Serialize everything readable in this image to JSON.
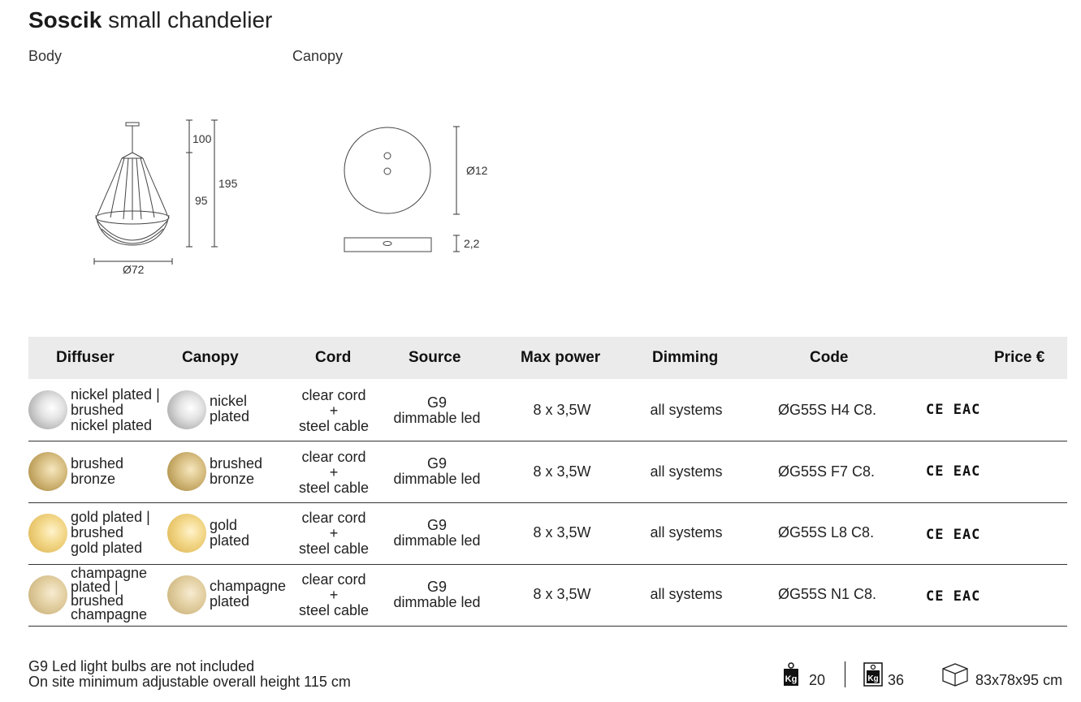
{
  "header": {
    "title_bold": "Soscik",
    "title_rest": "small chandelier",
    "body_label": "Body",
    "canopy_label": "Canopy"
  },
  "drawing": {
    "body_dims": {
      "top": "100",
      "lower": "95",
      "total": "195",
      "diameter": "Ø72"
    },
    "canopy_dims": {
      "diameter": "Ø12",
      "height": "2,2"
    }
  },
  "table": {
    "headers": [
      "Diffuser",
      "Canopy",
      "Cord",
      "Source",
      "Max power",
      "Dimming",
      "Code",
      "Price €"
    ],
    "rows": [
      {
        "diffuser": [
          "nickel plated |",
          "brushed",
          "nickel plated"
        ],
        "canopy": [
          "nickel",
          "plated"
        ],
        "cord": [
          "clear cord",
          "+",
          "steel cable"
        ],
        "source": [
          "G9",
          "dimmable led"
        ],
        "power": "8 x 3,5W",
        "dimming": "all systems",
        "code": "ØG55S H4 C8.",
        "cert": "CE EAC"
      },
      {
        "diffuser": [
          "brushed",
          "bronze"
        ],
        "canopy": [
          "brushed",
          "bronze"
        ],
        "cord": [
          "clear cord",
          "+",
          "steel cable"
        ],
        "source": [
          "G9",
          "dimmable led"
        ],
        "power": "8 x 3,5W",
        "dimming": "all systems",
        "code": "ØG55S F7 C8.",
        "cert": "CE EAC"
      },
      {
        "diffuser": [
          "gold plated |",
          "brushed",
          "gold plated"
        ],
        "canopy": [
          "gold",
          "plated"
        ],
        "cord": [
          "clear cord",
          "+",
          "steel cable"
        ],
        "source": [
          "G9",
          "dimmable led"
        ],
        "power": "8 x 3,5W",
        "dimming": "all systems",
        "code": "ØG55S L8 C8.",
        "cert": "CE EAC"
      },
      {
        "diffuser": [
          "champagne",
          "plated |",
          "brushed",
          "champagne"
        ],
        "canopy": [
          "champagne",
          "plated"
        ],
        "cord": [
          "clear cord",
          "+",
          "steel cable"
        ],
        "source": [
          "G9",
          "dimmable led"
        ],
        "power": "8 x 3,5W",
        "dimming": "all systems",
        "code": "ØG55S N1 C8.",
        "cert": "CE EAC"
      }
    ]
  },
  "footer": {
    "note1": "G9 Led light bulbs are not included",
    "note2": "On site minimum adjustable overall height 115 cm",
    "net_weight_icon": "Kg",
    "net_weight": "20",
    "gross_weight_icon": "Kg",
    "gross_weight": "36",
    "box_icon": "box-icon",
    "box_size": "83x78x95 cm"
  }
}
